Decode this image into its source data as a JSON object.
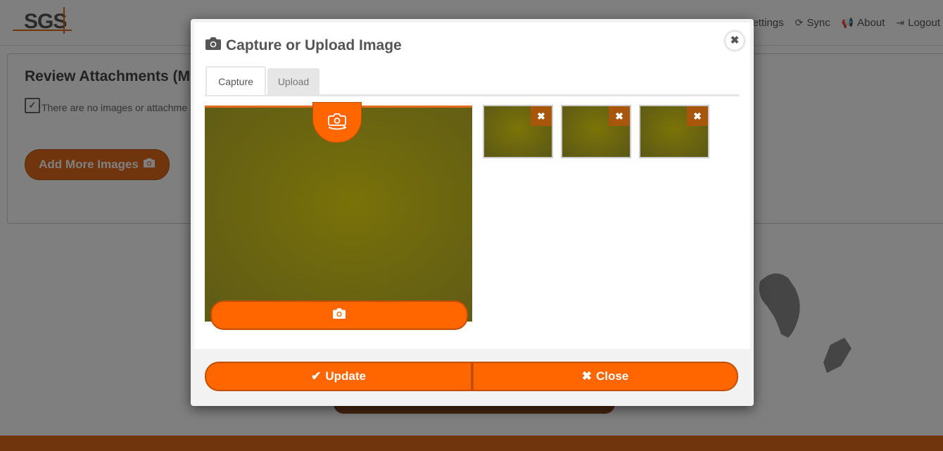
{
  "app": {
    "logo_text": "SGS",
    "nav": [
      {
        "label": "Settings",
        "icon": "gear-icon"
      },
      {
        "label": "Sync",
        "icon": "refresh-icon"
      },
      {
        "label": "About",
        "icon": "megaphone-icon"
      },
      {
        "label": "Logout",
        "icon": "logout-icon"
      }
    ]
  },
  "panel": {
    "title": "Review Attachments (M",
    "note": "There are no images or attachme",
    "add_more_label": "Add More Images"
  },
  "modal": {
    "title": "Capture or Upload Image",
    "tabs": [
      {
        "label": "Capture",
        "active": true
      },
      {
        "label": "Upload",
        "active": false
      }
    ],
    "thumbnails_count_visible": 3,
    "update_label": "Update",
    "close_label": "Close"
  },
  "colors": {
    "accent": "#ff6600",
    "accent_dark": "#c24e00",
    "thumb_remove": "#a8560c"
  }
}
